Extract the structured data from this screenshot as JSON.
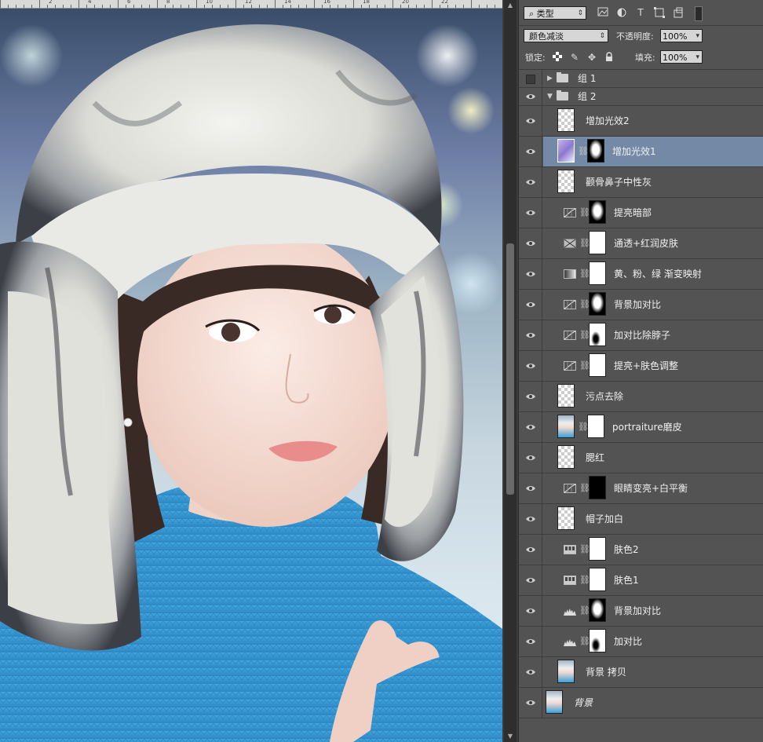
{
  "ruler": {
    "labels": [
      "2",
      "4",
      "6",
      "8",
      "10",
      "12",
      "14",
      "16",
      "18",
      "20",
      "22"
    ]
  },
  "panel": {
    "filter": {
      "kind": "类型",
      "icons": [
        "image-filter-icon",
        "adjustment-filter-icon",
        "type-filter-icon",
        "shape-filter-icon",
        "smart-object-filter-icon"
      ]
    },
    "blend_mode": "颜色减淡",
    "opacity_label": "不透明度:",
    "opacity_value": "100%",
    "lock_label": "锁定:",
    "fill_label": "填充:",
    "fill_value": "100%"
  },
  "layers": [
    {
      "name": "组 1",
      "type": "group",
      "expanded": false,
      "visible": false
    },
    {
      "name": "组 2",
      "type": "group",
      "expanded": true,
      "visible": true
    },
    {
      "name": "增加光效2",
      "type": "pixel",
      "thumb": "transparent",
      "visible": true
    },
    {
      "name": "增加光效1",
      "type": "pixel-mask",
      "thumb": "gradient-purple",
      "mask": "black-white",
      "visible": true,
      "selected": true
    },
    {
      "name": "颧骨鼻子中性灰",
      "type": "pixel",
      "thumb": "transparent",
      "visible": true
    },
    {
      "name": "提亮暗部",
      "type": "curves",
      "mask": "black-white",
      "visible": true
    },
    {
      "name": "通透+红润皮肤",
      "type": "channel-mixer",
      "mask": "white",
      "visible": true
    },
    {
      "name": "黄、粉、绿 渐变映射",
      "type": "gradient-map",
      "mask": "white",
      "visible": true
    },
    {
      "name": "背景加对比",
      "type": "curves",
      "mask": "black-white",
      "visible": true
    },
    {
      "name": "加对比除脖子",
      "type": "curves",
      "mask": "white-black",
      "visible": true
    },
    {
      "name": "提亮+肤色调整",
      "type": "curves",
      "mask": "white",
      "visible": true
    },
    {
      "name": "污点去除",
      "type": "pixel",
      "thumb": "transparent",
      "visible": true
    },
    {
      "name": "portraiture磨皮",
      "type": "pixel-mask",
      "thumb": "photo",
      "mask": "white",
      "visible": true
    },
    {
      "name": "腮红",
      "type": "pixel",
      "thumb": "transparent",
      "visible": true
    },
    {
      "name": "眼睛变亮+白平衡",
      "type": "curves",
      "mask": "black",
      "visible": true
    },
    {
      "name": "帽子加白",
      "type": "pixel",
      "thumb": "transparent",
      "visible": true
    },
    {
      "name": "肤色2",
      "type": "selective-color",
      "mask": "white",
      "visible": true
    },
    {
      "name": "肤色1",
      "type": "selective-color",
      "mask": "white",
      "visible": true
    },
    {
      "name": "背景加对比",
      "type": "levels",
      "mask": "black-white",
      "visible": true
    },
    {
      "name": "加对比",
      "type": "levels",
      "mask": "white-black",
      "visible": true
    },
    {
      "name": "背景 拷贝",
      "type": "pixel",
      "thumb": "photo",
      "visible": true
    },
    {
      "name": "背景",
      "type": "background",
      "thumb": "photo",
      "visible": true,
      "italic": true
    }
  ],
  "colors": {
    "panel_bg": "#535353",
    "selected_row": "#7389a6",
    "skin": "#f3d9cf",
    "sweater": "#3d9ed8",
    "fur_light": "#ecebe6",
    "fur_dark": "#3a3d42"
  }
}
